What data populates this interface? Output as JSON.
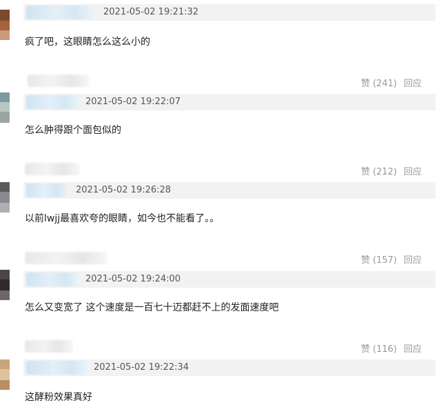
{
  "comments": [
    {
      "timestamp": "2021-05-02 19:21:32",
      "text": "疯了吧，这眼睛怎么这么小的",
      "likes": "赞 (241)",
      "reply": "回应"
    },
    {
      "timestamp": "2021-05-02 19:22:07",
      "text": "怎么肿得跟个面包似的",
      "likes": "赞 (212)",
      "reply": "回应"
    },
    {
      "timestamp": "2021-05-02 19:26:28",
      "text": "以前lwjj最喜欢夸的眼睛，如今也不能看了。。",
      "likes": "赞 (157)",
      "reply": "回应"
    },
    {
      "timestamp": "2021-05-02 19:24:00",
      "text": "怎么又变宽了 这个速度是一百七十迈都赶不上的发面速度吧",
      "likes": "赞 (116)",
      "reply": "回应"
    },
    {
      "timestamp": "2021-05-02 19:22:34",
      "text": "这酵粉效果真好"
    }
  ],
  "colors": {
    "meta_bar": "#f2f2f2",
    "name_blur": "#d5e7f3",
    "action_text": "#999999"
  }
}
